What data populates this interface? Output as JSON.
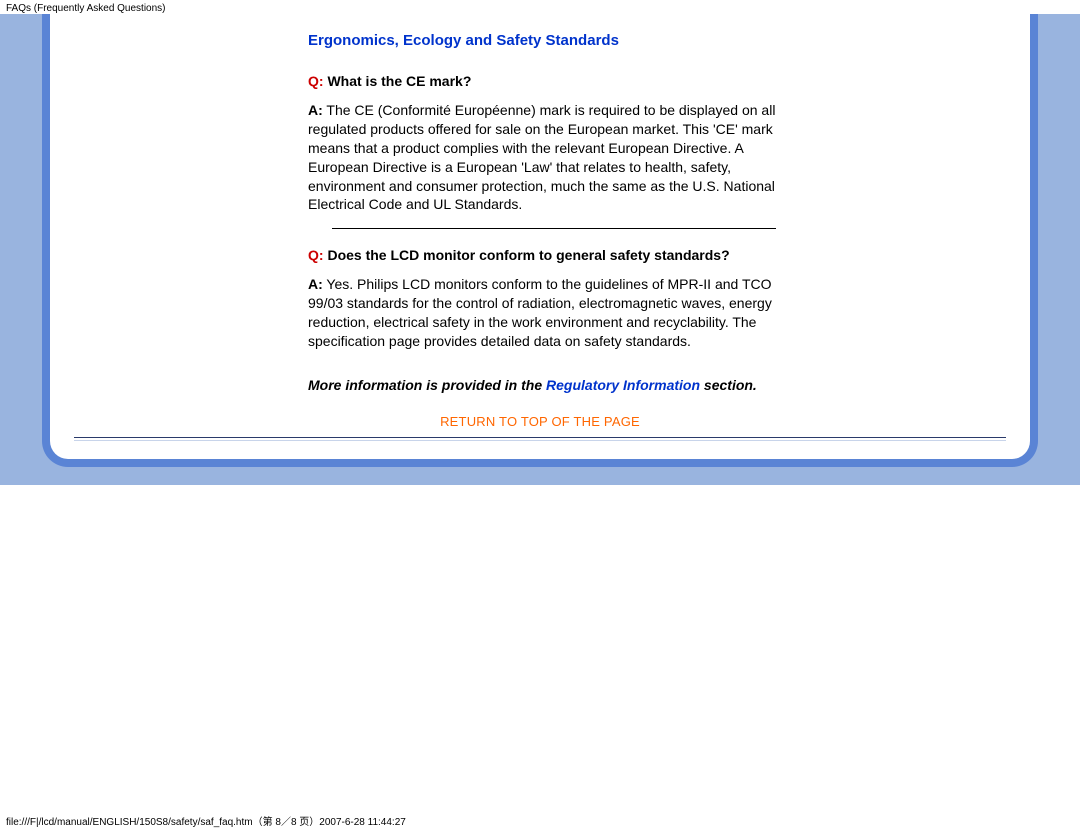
{
  "header": {
    "title": "FAQs (Frequently Asked Questions)"
  },
  "section": {
    "title": "Ergonomics, Ecology and Safety Standards"
  },
  "faq": [
    {
      "q_prefix": "Q:",
      "q_text": " What is the CE mark?",
      "a_prefix": "A:",
      "a_text": " The CE (Conformité Européenne) mark is required to be displayed on all regulated products offered for sale on the European market. This 'CE' mark means that a product complies with the relevant European Directive. A European Directive is a European 'Law' that relates to health, safety, environment and consumer protection, much the same as the U.S. National Electrical Code and UL Standards."
    },
    {
      "q_prefix": "Q:",
      "q_text": " Does the LCD monitor conform to general safety standards?",
      "a_prefix": "A:",
      "a_text": " Yes. Philips LCD monitors conform to the guidelines of MPR-II and TCO 99/03 standards for the control of radiation, electromagnetic waves, energy reduction, electrical safety in the work environment and recyclability. The specification page provides detailed data on safety standards."
    }
  ],
  "more_info": {
    "prefix": "More information is provided in the ",
    "link_text": "Regulatory Information",
    "suffix": " section."
  },
  "return_link": "RETURN TO TOP OF THE PAGE",
  "footer": {
    "path": "file:///F|/lcd/manual/ENGLISH/150S8/safety/saf_faq.htm（第 8／8 页）2007-6-28 11:44:27"
  }
}
